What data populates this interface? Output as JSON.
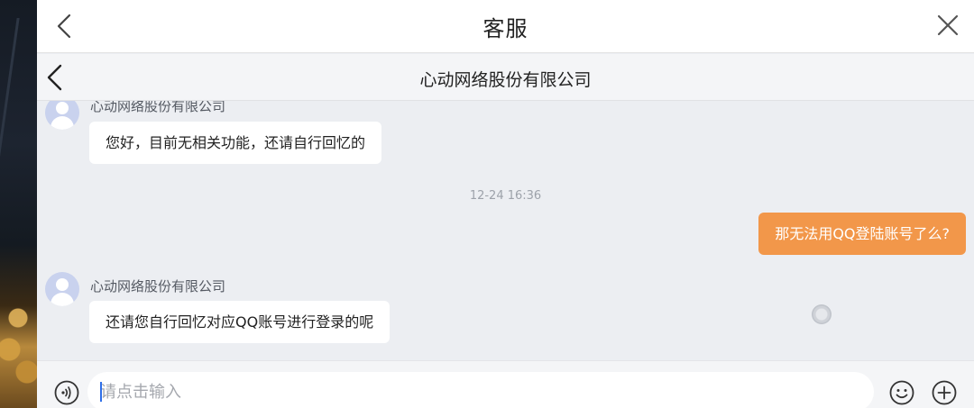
{
  "header": {
    "title": "客服"
  },
  "chat_header": {
    "title": "心动网络股份有限公司"
  },
  "messages": [
    {
      "sender": "心动网络股份有限公司",
      "text": "您好，目前无相关功能，还请自行回忆的"
    },
    {
      "timestamp": "12-24 16:36"
    },
    {
      "text": "那无法用QQ登陆账号了么?"
    },
    {
      "sender": "心动网络股份有限公司",
      "text": "还请您自行回忆对应QQ账号进行登录的呢"
    }
  ],
  "input": {
    "placeholder": "请点击输入",
    "value": ""
  },
  "colors": {
    "outgoing_bubble": "#f2974a",
    "incoming_bubble": "#ffffff",
    "chat_background": "#eceef2"
  },
  "icons": [
    "back-icon",
    "close-icon",
    "voice-icon",
    "emoji-icon",
    "plus-icon"
  ]
}
